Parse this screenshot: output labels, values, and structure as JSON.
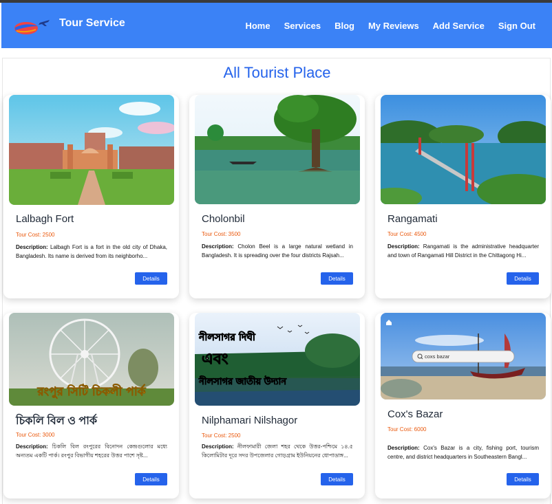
{
  "brand": {
    "name": "Tour Service"
  },
  "nav": {
    "items": [
      "Home",
      "Services",
      "Blog",
      "My Reviews",
      "Add Service",
      "Sign Out"
    ]
  },
  "page": {
    "heading": "All Tourist Place"
  },
  "cards": [
    {
      "title": "Lalbagh Fort",
      "cost": "Tour Cost: 2500",
      "desc_label": "Description:",
      "desc": "Lalbagh Fort is a fort in the old city of Dhaka, Bangladesh. Its name is derived from its neighborho...",
      "button": "Details"
    },
    {
      "title": "Cholonbil",
      "cost": "Tour Cost: 3500",
      "desc_label": "Description:",
      "desc": "Cholon Beel is a large natural wetland in Bangladesh. It is spreading over the four districts Rajsah...",
      "button": "Details"
    },
    {
      "title": "Rangamati",
      "cost": "Tour Cost: 4500",
      "desc_label": "Description:",
      "desc": "Rangamati is the administrative headquarter and town of Rangamati Hill District in the Chittagong Hi...",
      "button": "Details"
    },
    {
      "title": "চিকলি বিল ও পার্ক",
      "cost": "Tour Cost: 3000",
      "desc_label": "Description:",
      "desc": "চিকলি বিল রংপুরের বিনোদন কেন্দ্রগুলোর মধ্যে অন্যতম একটি পার্ক। রংপুর বিভাগীয় শহরের উত্তর পাশে সৃষ্ট...",
      "button": "Details",
      "image_text": "রংপুর সিটি চিকলী পার্ক"
    },
    {
      "title": "Nilphamari Nilshagor",
      "cost": "Tour Cost: 2500",
      "desc_label": "Description:",
      "desc": "নীলফামারী জেলা শহর থেকে উত্তর-পশ্চিমে ১৪.৫ কিলোমিটার দূরে সদর উপজেলার গোড়গ্রাম ইউনিয়নের ধোপাডাঙ্গ...",
      "button": "Details",
      "image_text": [
        "নীলসাগর দিঘী",
        "এবং",
        "নীলসাগর জাতীয় উদ্যান"
      ]
    },
    {
      "title": "Cox's Bazar",
      "cost": "Tour Cost: 6000",
      "desc_label": "Description:",
      "desc": "Cox's Bazar is a city, fishing port, tourism centre, and district headquarters in Southeastern Bangl...",
      "button": "Details",
      "image_text": "coxs bazar"
    }
  ]
}
